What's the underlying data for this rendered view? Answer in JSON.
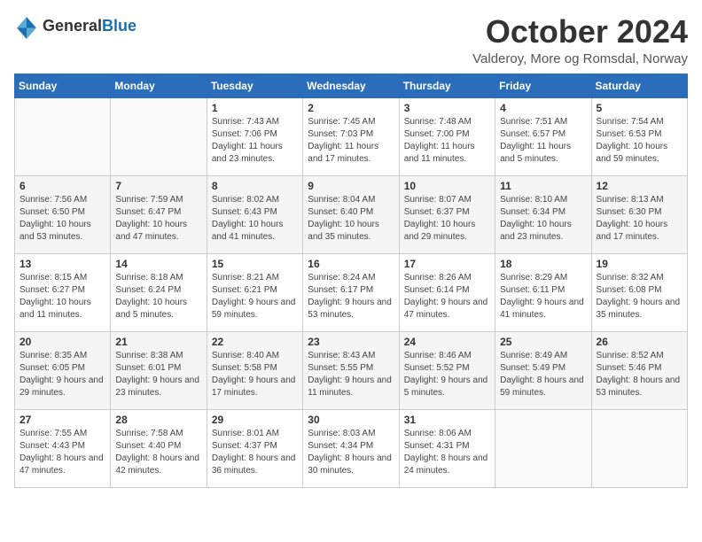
{
  "logo": {
    "general": "General",
    "blue": "Blue"
  },
  "title": "October 2024",
  "subtitle": "Valderoy, More og Romsdal, Norway",
  "days_of_week": [
    "Sunday",
    "Monday",
    "Tuesday",
    "Wednesday",
    "Thursday",
    "Friday",
    "Saturday"
  ],
  "weeks": [
    [
      {
        "day": "",
        "sunrise": "",
        "sunset": "",
        "daylight": ""
      },
      {
        "day": "",
        "sunrise": "",
        "sunset": "",
        "daylight": ""
      },
      {
        "day": "1",
        "sunrise": "Sunrise: 7:43 AM",
        "sunset": "Sunset: 7:06 PM",
        "daylight": "Daylight: 11 hours and 23 minutes."
      },
      {
        "day": "2",
        "sunrise": "Sunrise: 7:45 AM",
        "sunset": "Sunset: 7:03 PM",
        "daylight": "Daylight: 11 hours and 17 minutes."
      },
      {
        "day": "3",
        "sunrise": "Sunrise: 7:48 AM",
        "sunset": "Sunset: 7:00 PM",
        "daylight": "Daylight: 11 hours and 11 minutes."
      },
      {
        "day": "4",
        "sunrise": "Sunrise: 7:51 AM",
        "sunset": "Sunset: 6:57 PM",
        "daylight": "Daylight: 11 hours and 5 minutes."
      },
      {
        "day": "5",
        "sunrise": "Sunrise: 7:54 AM",
        "sunset": "Sunset: 6:53 PM",
        "daylight": "Daylight: 10 hours and 59 minutes."
      }
    ],
    [
      {
        "day": "6",
        "sunrise": "Sunrise: 7:56 AM",
        "sunset": "Sunset: 6:50 PM",
        "daylight": "Daylight: 10 hours and 53 minutes."
      },
      {
        "day": "7",
        "sunrise": "Sunrise: 7:59 AM",
        "sunset": "Sunset: 6:47 PM",
        "daylight": "Daylight: 10 hours and 47 minutes."
      },
      {
        "day": "8",
        "sunrise": "Sunrise: 8:02 AM",
        "sunset": "Sunset: 6:43 PM",
        "daylight": "Daylight: 10 hours and 41 minutes."
      },
      {
        "day": "9",
        "sunrise": "Sunrise: 8:04 AM",
        "sunset": "Sunset: 6:40 PM",
        "daylight": "Daylight: 10 hours and 35 minutes."
      },
      {
        "day": "10",
        "sunrise": "Sunrise: 8:07 AM",
        "sunset": "Sunset: 6:37 PM",
        "daylight": "Daylight: 10 hours and 29 minutes."
      },
      {
        "day": "11",
        "sunrise": "Sunrise: 8:10 AM",
        "sunset": "Sunset: 6:34 PM",
        "daylight": "Daylight: 10 hours and 23 minutes."
      },
      {
        "day": "12",
        "sunrise": "Sunrise: 8:13 AM",
        "sunset": "Sunset: 6:30 PM",
        "daylight": "Daylight: 10 hours and 17 minutes."
      }
    ],
    [
      {
        "day": "13",
        "sunrise": "Sunrise: 8:15 AM",
        "sunset": "Sunset: 6:27 PM",
        "daylight": "Daylight: 10 hours and 11 minutes."
      },
      {
        "day": "14",
        "sunrise": "Sunrise: 8:18 AM",
        "sunset": "Sunset: 6:24 PM",
        "daylight": "Daylight: 10 hours and 5 minutes."
      },
      {
        "day": "15",
        "sunrise": "Sunrise: 8:21 AM",
        "sunset": "Sunset: 6:21 PM",
        "daylight": "Daylight: 9 hours and 59 minutes."
      },
      {
        "day": "16",
        "sunrise": "Sunrise: 8:24 AM",
        "sunset": "Sunset: 6:17 PM",
        "daylight": "Daylight: 9 hours and 53 minutes."
      },
      {
        "day": "17",
        "sunrise": "Sunrise: 8:26 AM",
        "sunset": "Sunset: 6:14 PM",
        "daylight": "Daylight: 9 hours and 47 minutes."
      },
      {
        "day": "18",
        "sunrise": "Sunrise: 8:29 AM",
        "sunset": "Sunset: 6:11 PM",
        "daylight": "Daylight: 9 hours and 41 minutes."
      },
      {
        "day": "19",
        "sunrise": "Sunrise: 8:32 AM",
        "sunset": "Sunset: 6:08 PM",
        "daylight": "Daylight: 9 hours and 35 minutes."
      }
    ],
    [
      {
        "day": "20",
        "sunrise": "Sunrise: 8:35 AM",
        "sunset": "Sunset: 6:05 PM",
        "daylight": "Daylight: 9 hours and 29 minutes."
      },
      {
        "day": "21",
        "sunrise": "Sunrise: 8:38 AM",
        "sunset": "Sunset: 6:01 PM",
        "daylight": "Daylight: 9 hours and 23 minutes."
      },
      {
        "day": "22",
        "sunrise": "Sunrise: 8:40 AM",
        "sunset": "Sunset: 5:58 PM",
        "daylight": "Daylight: 9 hours and 17 minutes."
      },
      {
        "day": "23",
        "sunrise": "Sunrise: 8:43 AM",
        "sunset": "Sunset: 5:55 PM",
        "daylight": "Daylight: 9 hours and 11 minutes."
      },
      {
        "day": "24",
        "sunrise": "Sunrise: 8:46 AM",
        "sunset": "Sunset: 5:52 PM",
        "daylight": "Daylight: 9 hours and 5 minutes."
      },
      {
        "day": "25",
        "sunrise": "Sunrise: 8:49 AM",
        "sunset": "Sunset: 5:49 PM",
        "daylight": "Daylight: 8 hours and 59 minutes."
      },
      {
        "day": "26",
        "sunrise": "Sunrise: 8:52 AM",
        "sunset": "Sunset: 5:46 PM",
        "daylight": "Daylight: 8 hours and 53 minutes."
      }
    ],
    [
      {
        "day": "27",
        "sunrise": "Sunrise: 7:55 AM",
        "sunset": "Sunset: 4:43 PM",
        "daylight": "Daylight: 8 hours and 47 minutes."
      },
      {
        "day": "28",
        "sunrise": "Sunrise: 7:58 AM",
        "sunset": "Sunset: 4:40 PM",
        "daylight": "Daylight: 8 hours and 42 minutes."
      },
      {
        "day": "29",
        "sunrise": "Sunrise: 8:01 AM",
        "sunset": "Sunset: 4:37 PM",
        "daylight": "Daylight: 8 hours and 36 minutes."
      },
      {
        "day": "30",
        "sunrise": "Sunrise: 8:03 AM",
        "sunset": "Sunset: 4:34 PM",
        "daylight": "Daylight: 8 hours and 30 minutes."
      },
      {
        "day": "31",
        "sunrise": "Sunrise: 8:06 AM",
        "sunset": "Sunset: 4:31 PM",
        "daylight": "Daylight: 8 hours and 24 minutes."
      },
      {
        "day": "",
        "sunrise": "",
        "sunset": "",
        "daylight": ""
      },
      {
        "day": "",
        "sunrise": "",
        "sunset": "",
        "daylight": ""
      }
    ]
  ]
}
